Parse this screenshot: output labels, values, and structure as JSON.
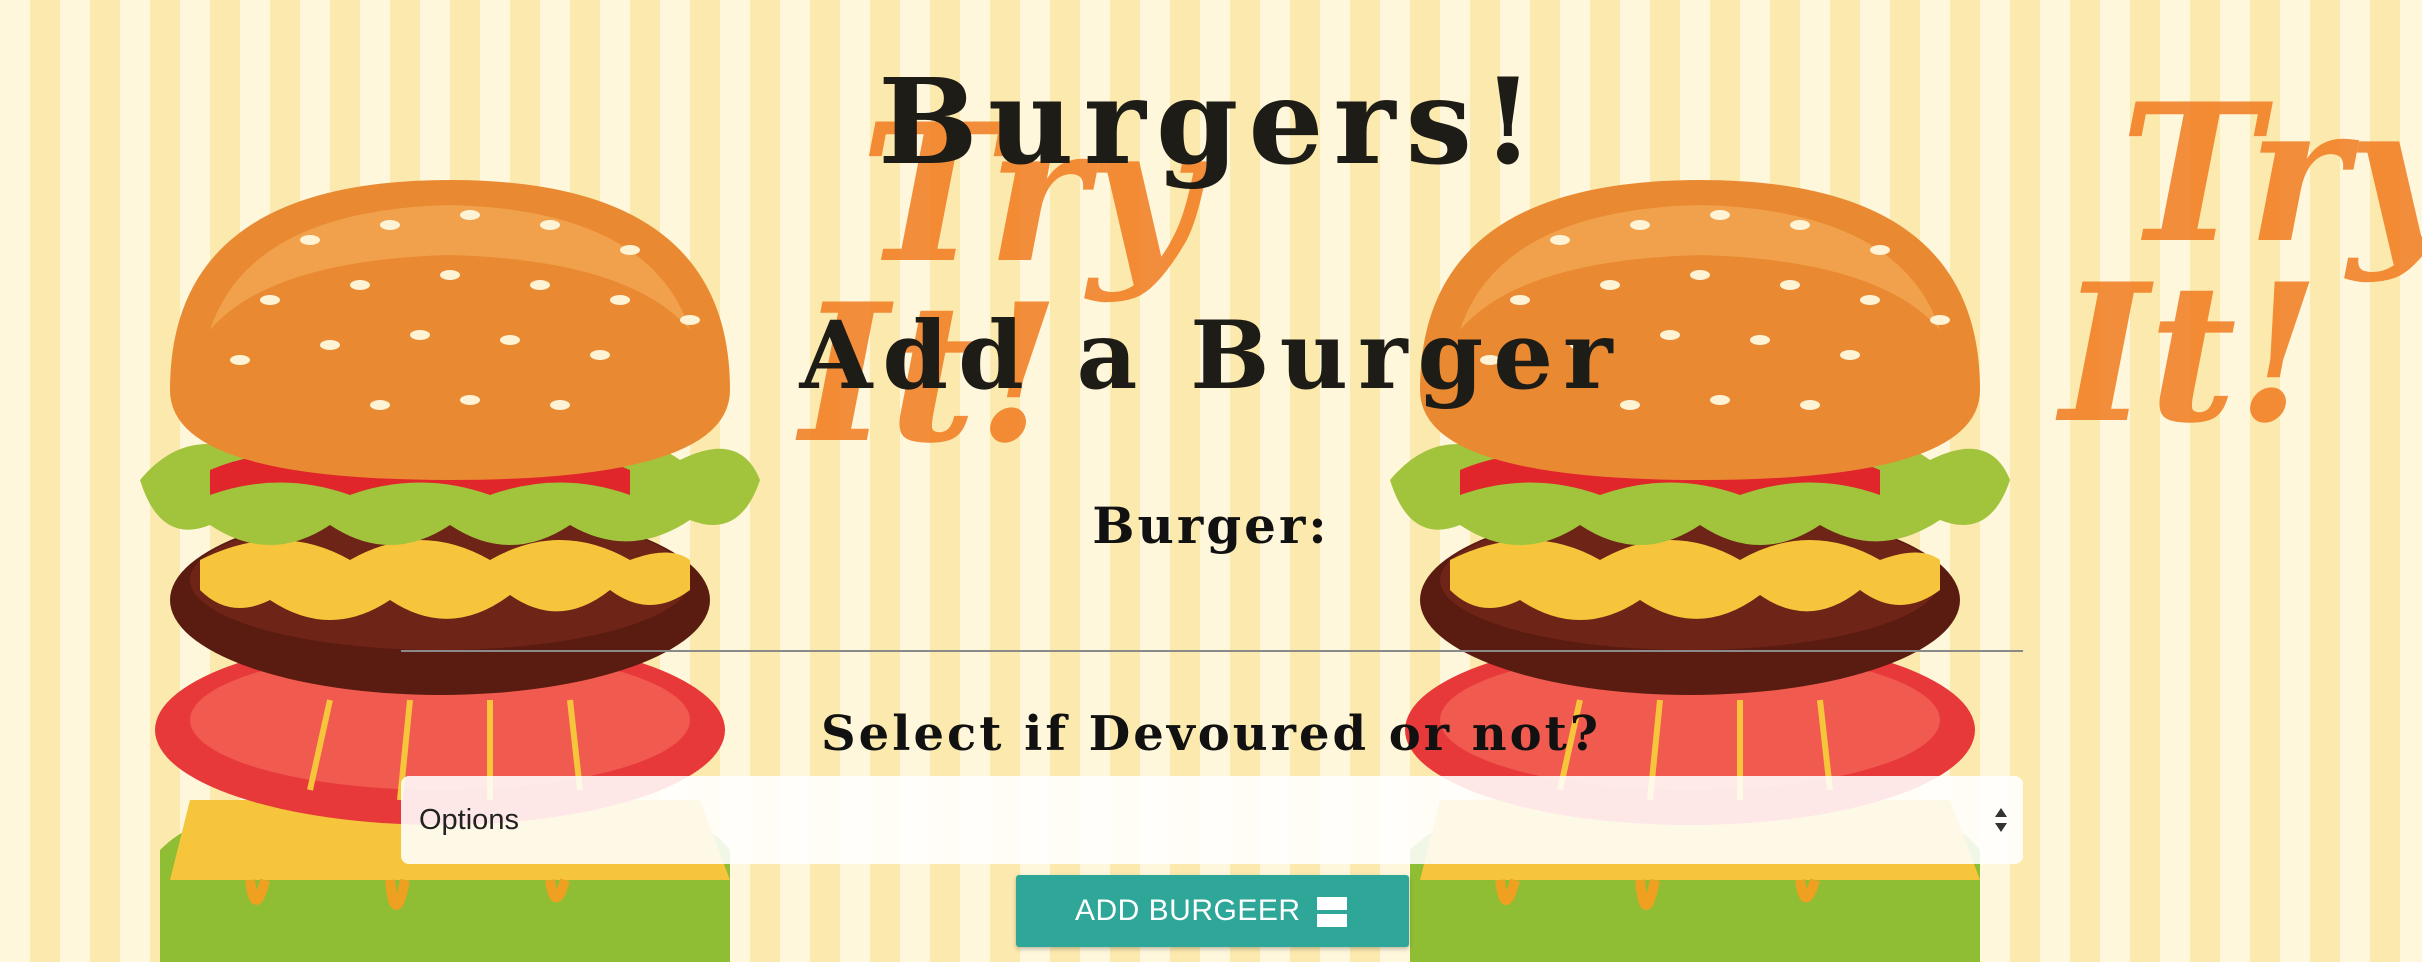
{
  "header": {
    "title": "Burgers!"
  },
  "form": {
    "heading": "Add a Burger",
    "burger_label": "Burger:",
    "burger_input_value": "",
    "devoured_label": "Select if Devoured or not?",
    "devoured_select_value": "Options",
    "submit_label": "ADD BURGEER",
    "submit_icon": "storage-icon"
  },
  "background": {
    "promo_text_line1": "Try",
    "promo_text_line2": "It!",
    "image": "burger-illustration",
    "colors": {
      "stripe_light": "#fff7dc",
      "stripe_dark": "#fbe9ae",
      "promo_orange": "#f07a1e",
      "button_teal": "#2ea799"
    }
  }
}
